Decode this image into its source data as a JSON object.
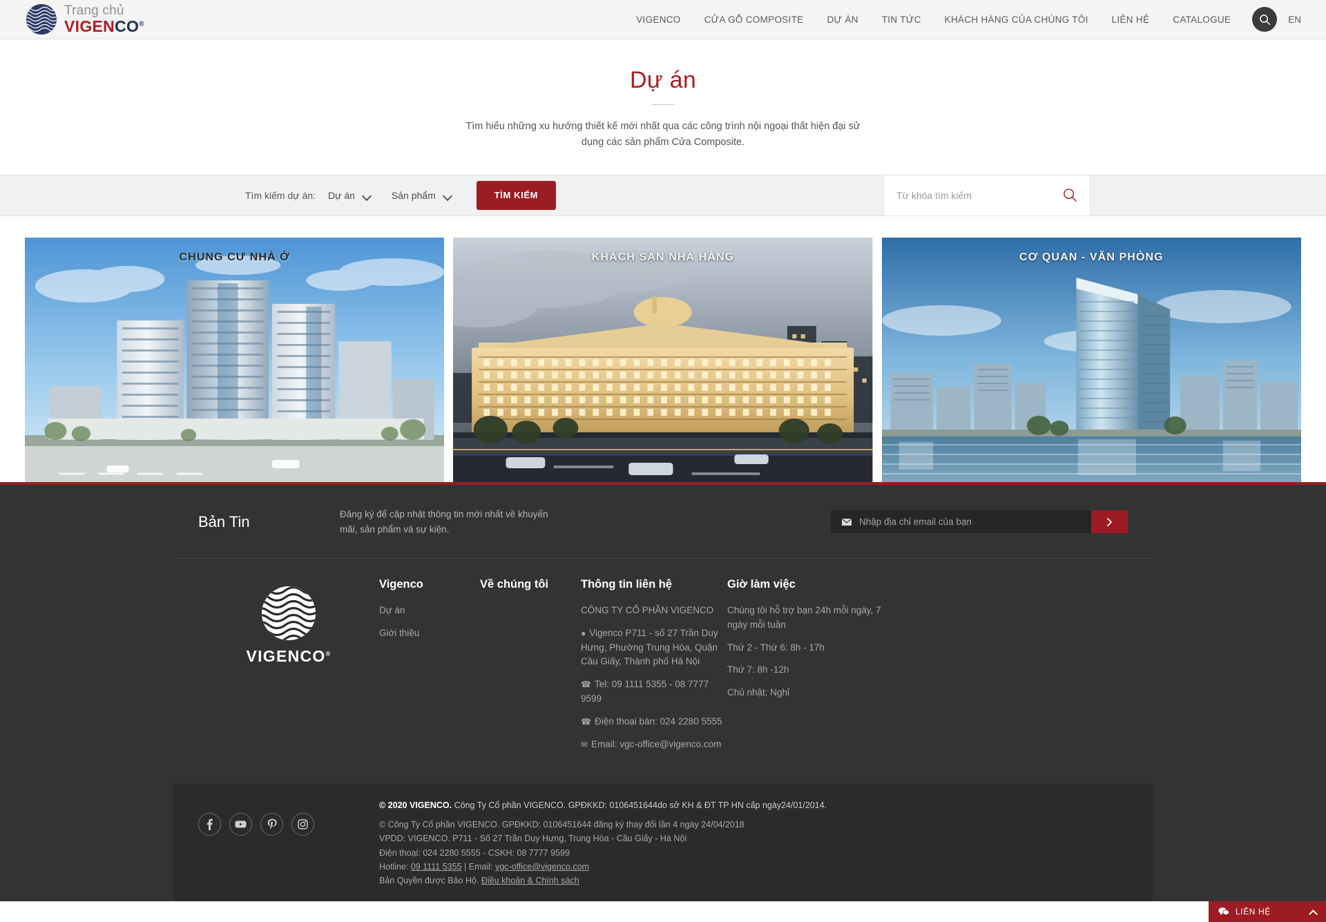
{
  "header": {
    "brand_top": "Trang chủ",
    "brand_vi": "VIGEN",
    "brand_co": "CO",
    "brand_reg": "®",
    "nav": [
      {
        "label": "VIGENCO"
      },
      {
        "label": "CỬA GỖ COMPOSITE"
      },
      {
        "label": "DỰ ÁN"
      },
      {
        "label": "TIN TỨC"
      },
      {
        "label": "KHÁCH HÀNG CỦA CHÚNG TÔI"
      },
      {
        "label": "LIÊN HỆ"
      },
      {
        "label": "CATALOGUE"
      }
    ],
    "search_icon": "search-icon",
    "lang": "EN"
  },
  "hero": {
    "title": "Dự án",
    "subtitle": "Tìm hiểu những xu hướng thiết kế mới nhất qua các công trình nội ngoại thất hiện đại sử dụng các sản phẩm Cửa Composite."
  },
  "filter": {
    "label": "Tìm kiếm dự án:",
    "project_select": "Dự án",
    "product_select": "Sản phẩm",
    "search_button": "TÌM KIẾM",
    "keyword_placeholder": "Từ khóa tìm kiếm",
    "keyword_value": ""
  },
  "cards": [
    {
      "label": "CHUNG CƯ NHÀ Ở",
      "name": "card-apartment"
    },
    {
      "label": "KHÁCH SẠN NHÀ HÀNG",
      "name": "card-hotel"
    },
    {
      "label": "CƠ QUAN - VĂN PHÒNG",
      "name": "card-office"
    }
  ],
  "newsletter": {
    "title": "Bản Tin",
    "description": "Đăng ký để cập nhật thông tin mới nhất về khuyến mãi, sản phẩm và sự kiện.",
    "email_placeholder": "Nhập địa chỉ email của bạn",
    "email_value": "",
    "submit_icon": "chevron-right-icon"
  },
  "footer": {
    "logo_name": "VIGENCO",
    "logo_reg": "®",
    "columns": {
      "vigenco": {
        "heading": "Vigenco",
        "links": [
          {
            "label": "Dự án"
          },
          {
            "label": "Giới thiệu"
          }
        ]
      },
      "about": {
        "heading": "Về chúng tôi",
        "links": []
      },
      "contact": {
        "heading": "Thông tin liên hệ",
        "company": "CÔNG TY CỔ PHẦN VIGENCO",
        "address": "Vigenco P711 - số 27 Trần Duy Hưng, Phường Trung Hòa, Quận Cầu Giấy, Thành phố Hà Nội",
        "tel": "Tel: 09 1111 5355 - 08 7777 9599",
        "landline": "Điện thoại bàn: 024 2280 5555",
        "email": "Email: vgc-office@vigenco.com"
      },
      "hours": {
        "heading": "Giờ làm việc",
        "lines": [
          "Chúng tôi hỗ trợ bạn 24h mỗi ngày, 7 ngày mỗi tuần",
          "Thứ 2 - Thứ 6: 8h - 17h",
          "Thứ 7: 8h -12h",
          "Chủ nhật: Nghỉ"
        ]
      }
    },
    "socials": [
      {
        "name": "facebook-icon",
        "glyph": "f"
      },
      {
        "name": "youtube-icon",
        "glyph": "▶"
      },
      {
        "name": "pinterest-icon",
        "glyph": "p"
      },
      {
        "name": "instagram-icon",
        "glyph": "◎"
      }
    ],
    "legal": {
      "line1_bold": "© 2020 VIGENCO.",
      "line1_rest": "Công Ty Cổ phần VIGENCO. GPĐKKD: 0106451644do sở KH & ĐT TP HN cấp ngày24/01/2014.",
      "line2": "© Công Ty Cổ phần VIGENCO. GPĐKKD: 0106451644 đăng ký thay đổi lần 4 ngày 24/04/2018",
      "line3": "VPDD: VIGENCO. P711 - Số 27 Trần Duy Hưng, Trung Hòa - Cầu Giấy - Hà Nội",
      "line4": "Điện thoại: 024 2280 5555  - CSKH: 08 7777 9599",
      "line5_prefix": "Hotline: ",
      "line5_hotline": "09 1111 5355",
      "line5_mid": " | Email: ",
      "line5_email": "vgc-office@vigenco.com",
      "line6_prefix": "Bản Quyền được Bảo Hộ. ",
      "line6_link": "Điều khoản & Chính sách"
    }
  },
  "chat": {
    "label": "LIÊN HỆ",
    "icon": "chat-bubble-icon",
    "caret": "chevron-up-icon"
  },
  "colors": {
    "accent": "#9d1b22",
    "title": "#b01e24",
    "footer_bg": "#333333",
    "footer_bottom_bg": "#2b2b2b",
    "header_bg": "#f4f4f4"
  }
}
